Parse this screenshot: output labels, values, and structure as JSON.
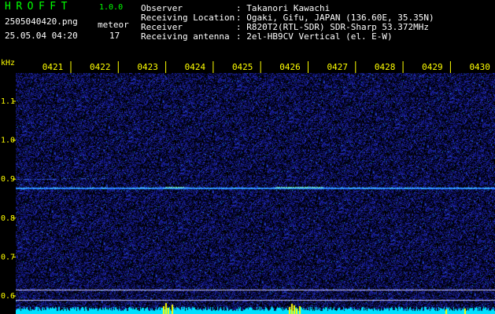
{
  "header": {
    "app_name": "HROFFT",
    "app_version": "1.0.0",
    "file_name": "2505040420.png",
    "meteor_label": "meteor",
    "datetime": "25.05.04 04:20",
    "meteor_count": "17"
  },
  "info": [
    {
      "key": "Observer",
      "value": ": Takanori Kawachi"
    },
    {
      "key": "Receiving Location",
      "value": ": Ogaki, Gifu, JAPAN (136.60E, 35.35N)"
    },
    {
      "key": "Receiver",
      "value": ": R820T2(RTL-SDR) SDR-Sharp 53.372MHz"
    },
    {
      "key": "Receiving antenna",
      "value": ": 2el-HB9CV Vertical (el. E-W)"
    }
  ],
  "axis": {
    "unit": "kHz",
    "time_labels": [
      "0421",
      "0422",
      "0423",
      "0424",
      "0425",
      "0426",
      "0427",
      "0428",
      "0429",
      "0430"
    ],
    "freq_labels": [
      "1.1",
      "1.0",
      "0.9",
      "0.8",
      "0.7",
      "0.6"
    ]
  },
  "colors": {
    "header_text": "#00ff00",
    "info_text": "#ffffff",
    "axis_text": "#ffff00",
    "background": "#000000",
    "noise": "#1a1aa0",
    "carrier": "#40c0ff",
    "activity_bar": "#00e0ff",
    "meteor_spike": "#ffff00"
  }
}
